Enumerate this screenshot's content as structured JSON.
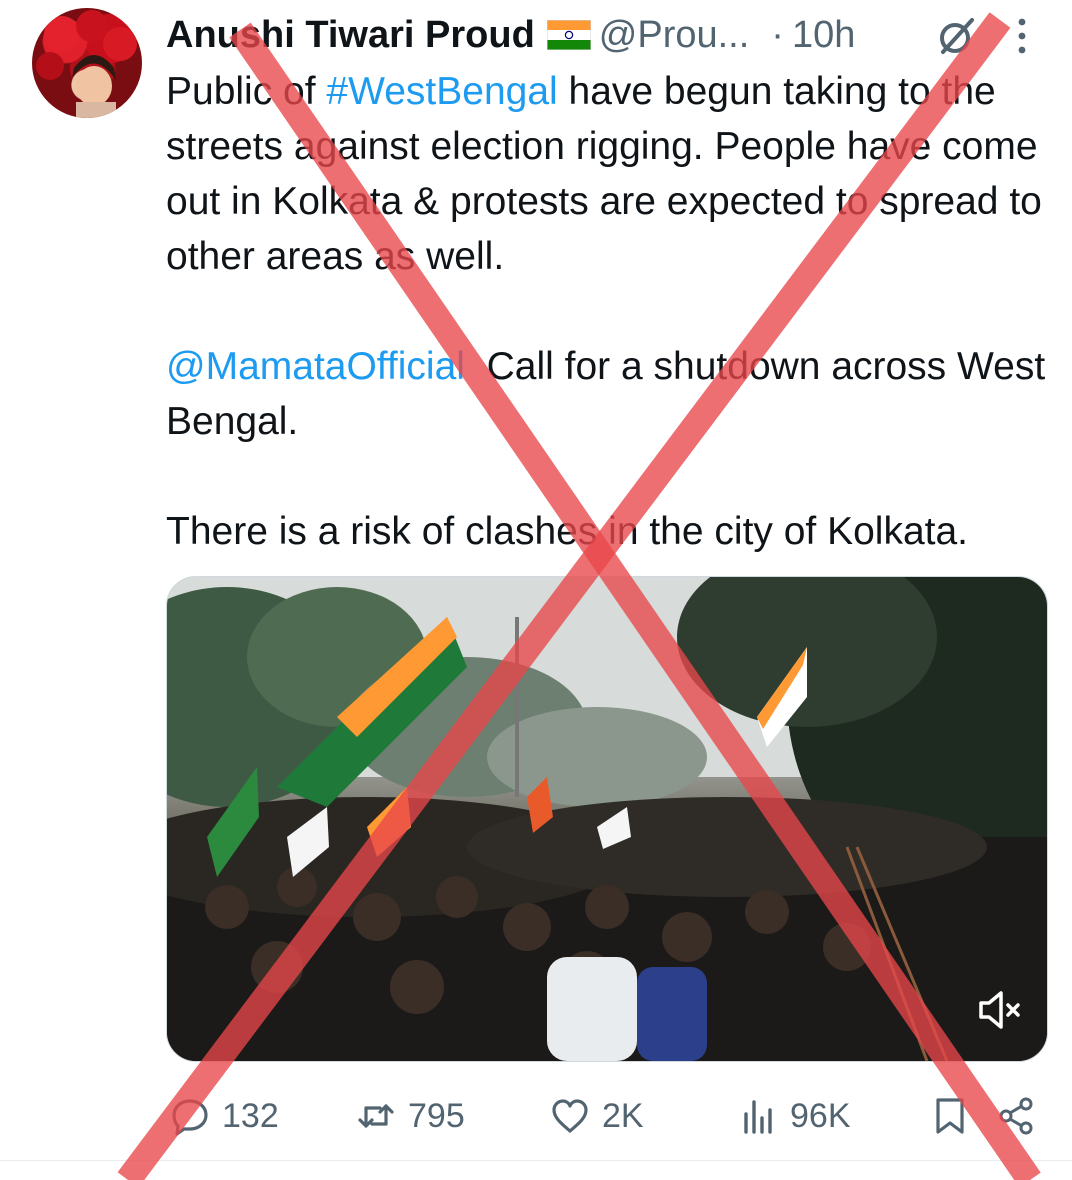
{
  "post": {
    "author_name": "Anushi Tiwari Proud",
    "handle": "@Prou...",
    "separator": "·",
    "time": "10h",
    "text": {
      "p1_before": "Public of ",
      "p1_hashtag": "#WestBengal",
      "p1_after": " have begun taking to the streets against election rigging. People have come out in Kolkata & protests are expected to spread to other areas as well.",
      "p2_mention": "@MamataOfficial",
      "p2_after": "  Call for a shutdown across West Bengal.",
      "p3": "There is a risk of clashes in the city of Kolkata."
    }
  },
  "actions": {
    "replies": "132",
    "reposts": "795",
    "likes": "2K",
    "views": "96K"
  },
  "icons": {
    "flag": "india-flag-icon",
    "grok": "grok-icon",
    "more": "more-options-icon",
    "mute": "muted-speaker-icon",
    "reply": "reply-icon",
    "repost": "repost-icon",
    "like": "like-icon",
    "views": "views-icon",
    "bookmark": "bookmark-icon",
    "share": "share-icon"
  },
  "colors": {
    "link": "#1d9bf0",
    "muted_text": "#536471",
    "overlay_cross": "#e8474a"
  }
}
